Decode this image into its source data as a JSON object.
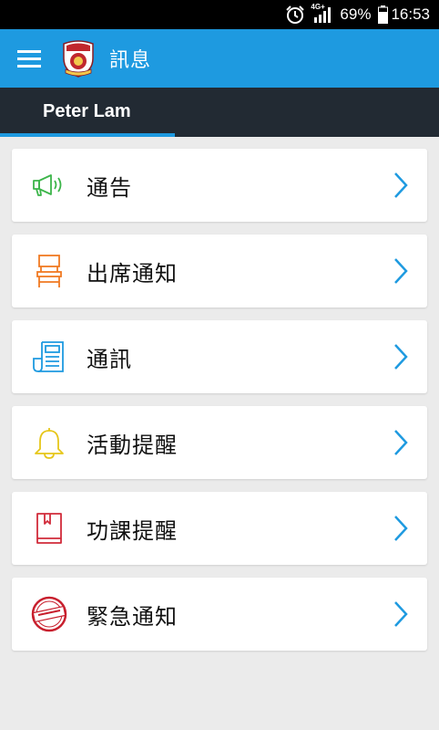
{
  "status_bar": {
    "network": "4G+",
    "battery": "69%",
    "time": "16:53",
    "icons": [
      "alarm-icon",
      "signal-icon",
      "battery-icon"
    ]
  },
  "app_bar": {
    "title": "訊息",
    "menu_icon": "hamburger-menu-icon",
    "logo": "school-crest-logo",
    "color": "#1e9ae0"
  },
  "user": {
    "name": "Peter Lam"
  },
  "items": [
    {
      "label": "通告",
      "icon": "megaphone-icon",
      "color": "#3cb54a"
    },
    {
      "label": "出席通知",
      "icon": "chair-icon",
      "color": "#f07a22"
    },
    {
      "label": "通訊",
      "icon": "newsletter-icon",
      "color": "#1e9ae0"
    },
    {
      "label": "活動提醒",
      "icon": "bell-icon",
      "color": "#e6c619"
    },
    {
      "label": "功課提醒",
      "icon": "book-icon",
      "color": "#d12b3a"
    },
    {
      "label": "緊急通知",
      "icon": "urgent-stamp-icon",
      "color": "#c8202e"
    }
  ],
  "chevron_color": "#1e9ae0"
}
